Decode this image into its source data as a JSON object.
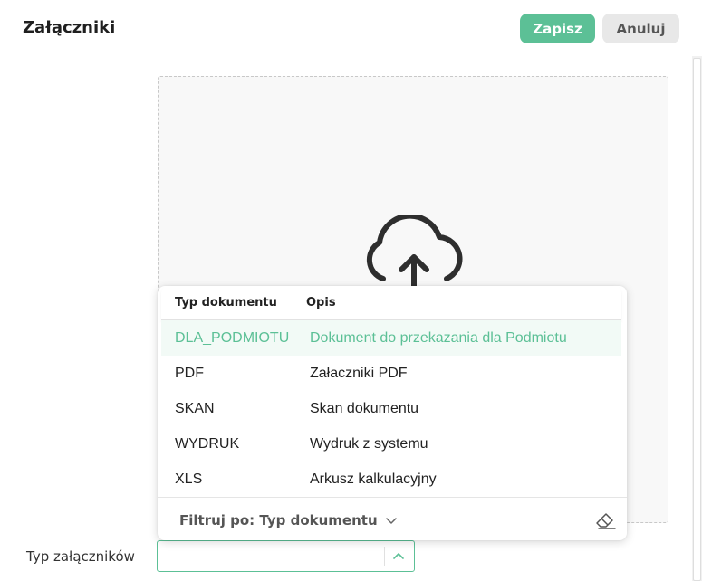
{
  "header": {
    "title": "Załączniki",
    "save_label": "Zapisz",
    "cancel_label": "Anuluj"
  },
  "colors": {
    "accent": "#5cc096",
    "cancel_bg": "#e8e8e8"
  },
  "dropzone": {
    "icon": "cloud-upload-icon"
  },
  "dropdown": {
    "columns": [
      "Typ dokumentu",
      "Opis"
    ],
    "rows": [
      {
        "type": "DLA_PODMIOTU",
        "description": "Dokument do przekazania dla Podmiotu",
        "selected": true
      },
      {
        "type": "PDF",
        "description": "Załaczniki PDF",
        "selected": false
      },
      {
        "type": "SKAN",
        "description": "Skan dokumentu",
        "selected": false
      },
      {
        "type": "WYDRUK",
        "description": "Wydruk z systemu",
        "selected": false
      },
      {
        "type": "XLS",
        "description": "Arkusz kalkulacyjny",
        "selected": false
      }
    ],
    "filter_label": "Filtruj po: Typ dokumentu",
    "clear_icon": "eraser-icon"
  },
  "field": {
    "label": "Typ załączników",
    "value": ""
  }
}
